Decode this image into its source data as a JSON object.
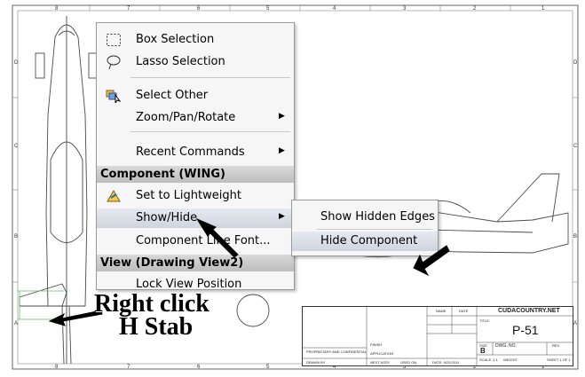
{
  "context_menu": {
    "items": [
      {
        "label": "Box Selection",
        "icon": "box-selection-icon"
      },
      {
        "label": "Lasso Selection",
        "icon": "lasso-selection-icon"
      },
      {
        "label": "Select Other",
        "icon": "select-other-icon"
      },
      {
        "label": "Zoom/Pan/Rotate",
        "has_submenu": true
      },
      {
        "label": "Recent Commands",
        "has_submenu": true
      }
    ],
    "component_header": "Component (WING)",
    "component_items": [
      {
        "label": "Set to Lightweight",
        "icon": "lightweight-icon"
      },
      {
        "label": "Show/Hide",
        "has_submenu": true,
        "highlighted": true
      },
      {
        "label": "Component Line Font..."
      }
    ],
    "view_header": "View (Drawing View2)",
    "view_items": [
      {
        "label": "Lock View Position"
      }
    ]
  },
  "submenu": {
    "items": [
      {
        "label": "Show Hidden Edges"
      },
      {
        "label": "Hide Component",
        "highlighted": true
      }
    ]
  },
  "annotation": {
    "line1": "Right click",
    "line2": "H Stab"
  },
  "title_block": {
    "company": "CUDACOUNTRY.NET",
    "title_label": "TITLE:",
    "title": "P-51",
    "size_label": "SIZE",
    "size": "B",
    "dwg_no_label": "DWG.  NO.",
    "rev_label": "REV",
    "scale": "SCALE: 1:1",
    "weight": "WEIGHT:",
    "sheet": "SHEET 1 OF 1",
    "proprietary": "PROPRIETARY AND CONFIDENTIAL",
    "drawn": "DRAWN BY",
    "finish": "FINISH",
    "application": "APPLICATION",
    "next_assy": "NEXT ASSY",
    "used_on": "USED ON",
    "name_col": "NAME",
    "date_col": "DATE",
    "date": "DATE: 9/22/2011"
  },
  "border_numbers": [
    "8",
    "7",
    "6",
    "5",
    "4",
    "3",
    "2",
    "1"
  ],
  "border_letters": [
    "D",
    "C",
    "B",
    "A"
  ],
  "colors": {
    "menu_bg": "#f6f6f6",
    "header_bg": "#c6c6c6",
    "highlight": "#d8dde7",
    "drawing_line": "#4a4a4a"
  }
}
